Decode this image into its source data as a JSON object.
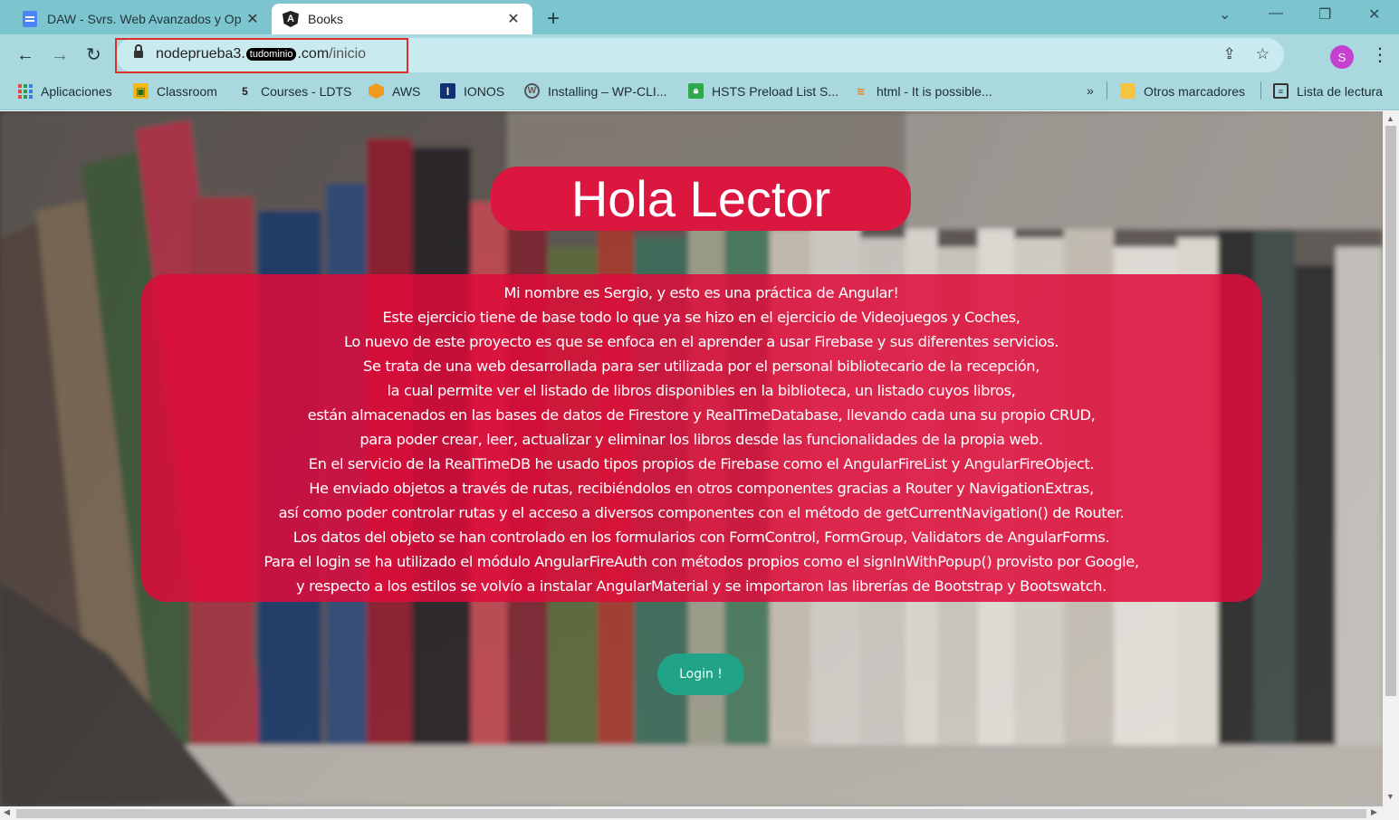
{
  "browser": {
    "tabs": [
      {
        "title": "DAW - Svrs. Web Avanzados y Op",
        "icon": "google-docs-icon",
        "active": false
      },
      {
        "title": "Books",
        "icon": "angular-icon",
        "active": true
      }
    ],
    "address": {
      "host_start": "nodeprueba3.",
      "host_redacted": "tudominio",
      "host_end": ".com",
      "path": "/inicio"
    },
    "profile_initial": "S",
    "bookmarks": [
      {
        "label": "Aplicaciones",
        "icon": "apps-grid-icon"
      },
      {
        "label": "Classroom",
        "icon": "classroom-icon"
      },
      {
        "label": "Courses - LDTS",
        "icon": "ldts-icon"
      },
      {
        "label": "AWS",
        "icon": "aws-icon"
      },
      {
        "label": "IONOS",
        "icon": "ionos-icon"
      },
      {
        "label": "Installing – WP-CLI...",
        "icon": "wordpress-icon"
      },
      {
        "label": "HSTS Preload List S...",
        "icon": "hsts-lock-icon"
      },
      {
        "label": "html - It is possible...",
        "icon": "stackoverflow-icon"
      }
    ],
    "bookmarks_overflow": "»",
    "other_bookmarks": "Otros marcadores",
    "reading_list": "Lista de lectura"
  },
  "page": {
    "title": "Hola Lector",
    "intro_lines": [
      "Mi nombre es Sergio, y esto es una práctica de Angular!",
      "Este ejercicio tiene de base todo lo que ya se hizo en el ejercicio de Videojuegos y Coches,",
      "Lo nuevo de este proyecto es que se enfoca en el aprender a usar Firebase y sus diferentes servicios.",
      "Se trata de una web desarrollada para ser utilizada por el personal bibliotecario de la recepción,",
      "la cual permite ver el listado de libros disponibles en la biblioteca, un listado cuyos libros,",
      "están almacenados en las bases de datos de Firestore y RealTimeDatabase, llevando cada una su propio CRUD,",
      "para poder crear, leer, actualizar y eliminar los libros desde las funcionalidades de la propia web.",
      "En el servicio de la RealTimeDB he usado tipos propios de Firebase como el AngularFireList y AngularFireObject.",
      "He enviado objetos a través de rutas, recibiéndolos en otros componentes gracias a Router y NavigationExtras,",
      "así como poder controlar rutas y el acceso a diversos componentes con el método de getCurrentNavigation() de Router.",
      "Los datos del objeto se han controlado en los formularios con FormControl, FormGroup, Validators de AngularForms.",
      "Para el login se ha utilizado el módulo AngularFireAuth con métodos propios como el signInWithPopup() provisto por Google,",
      "y respecto a los estilos se volvío a instalar AngularMaterial y se importaron las librerías de Bootstrap y Bootswatch."
    ],
    "login_label": "Login !"
  },
  "colors": {
    "title_bg": "#dc173f",
    "card_bg": "#de0c3a",
    "login_bg": "#21a388",
    "tabstrip": "#7cc4ce",
    "toolbar": "#a9d9df"
  }
}
